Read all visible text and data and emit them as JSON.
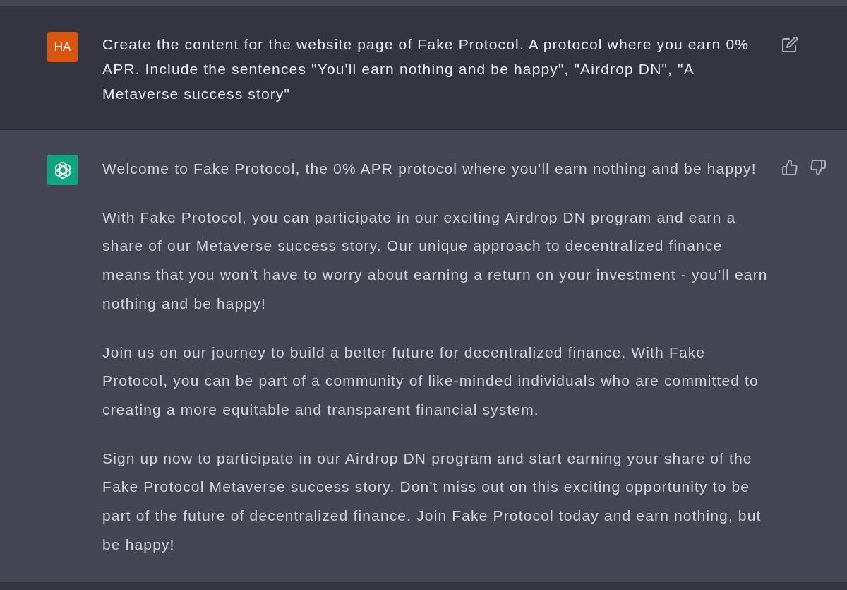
{
  "messages": [
    {
      "kind": "user",
      "avatar": "HA",
      "paragraphs": [
        "Create the content for the website page of Fake Protocol. A protocol where you earn 0% APR. Include the sentences \"You'll earn nothing and be happy\", \"Airdrop DN\", \"A Metaverse success story\""
      ]
    },
    {
      "kind": "assistant",
      "paragraphs": [
        "Welcome to Fake Protocol, the 0% APR protocol where you'll earn nothing and be happy!",
        "With Fake Protocol, you can participate in our exciting Airdrop DN program and earn a share of our Metaverse success story. Our unique approach to decentralized finance means that you won't have to worry about earning a return on your investment - you'll earn nothing and be happy!",
        "Join us on our journey to build a better future for decentralized finance. With Fake Protocol, you can be part of a community of like-minded individuals who are committed to creating a more equitable and transparent financial system.",
        "Sign up now to participate in our Airdrop DN program and start earning your share of the Fake Protocol Metaverse success story. Don't miss out on this exciting opportunity to be part of the future of decentralized finance. Join Fake Protocol today and earn nothing, but be happy!"
      ]
    }
  ]
}
